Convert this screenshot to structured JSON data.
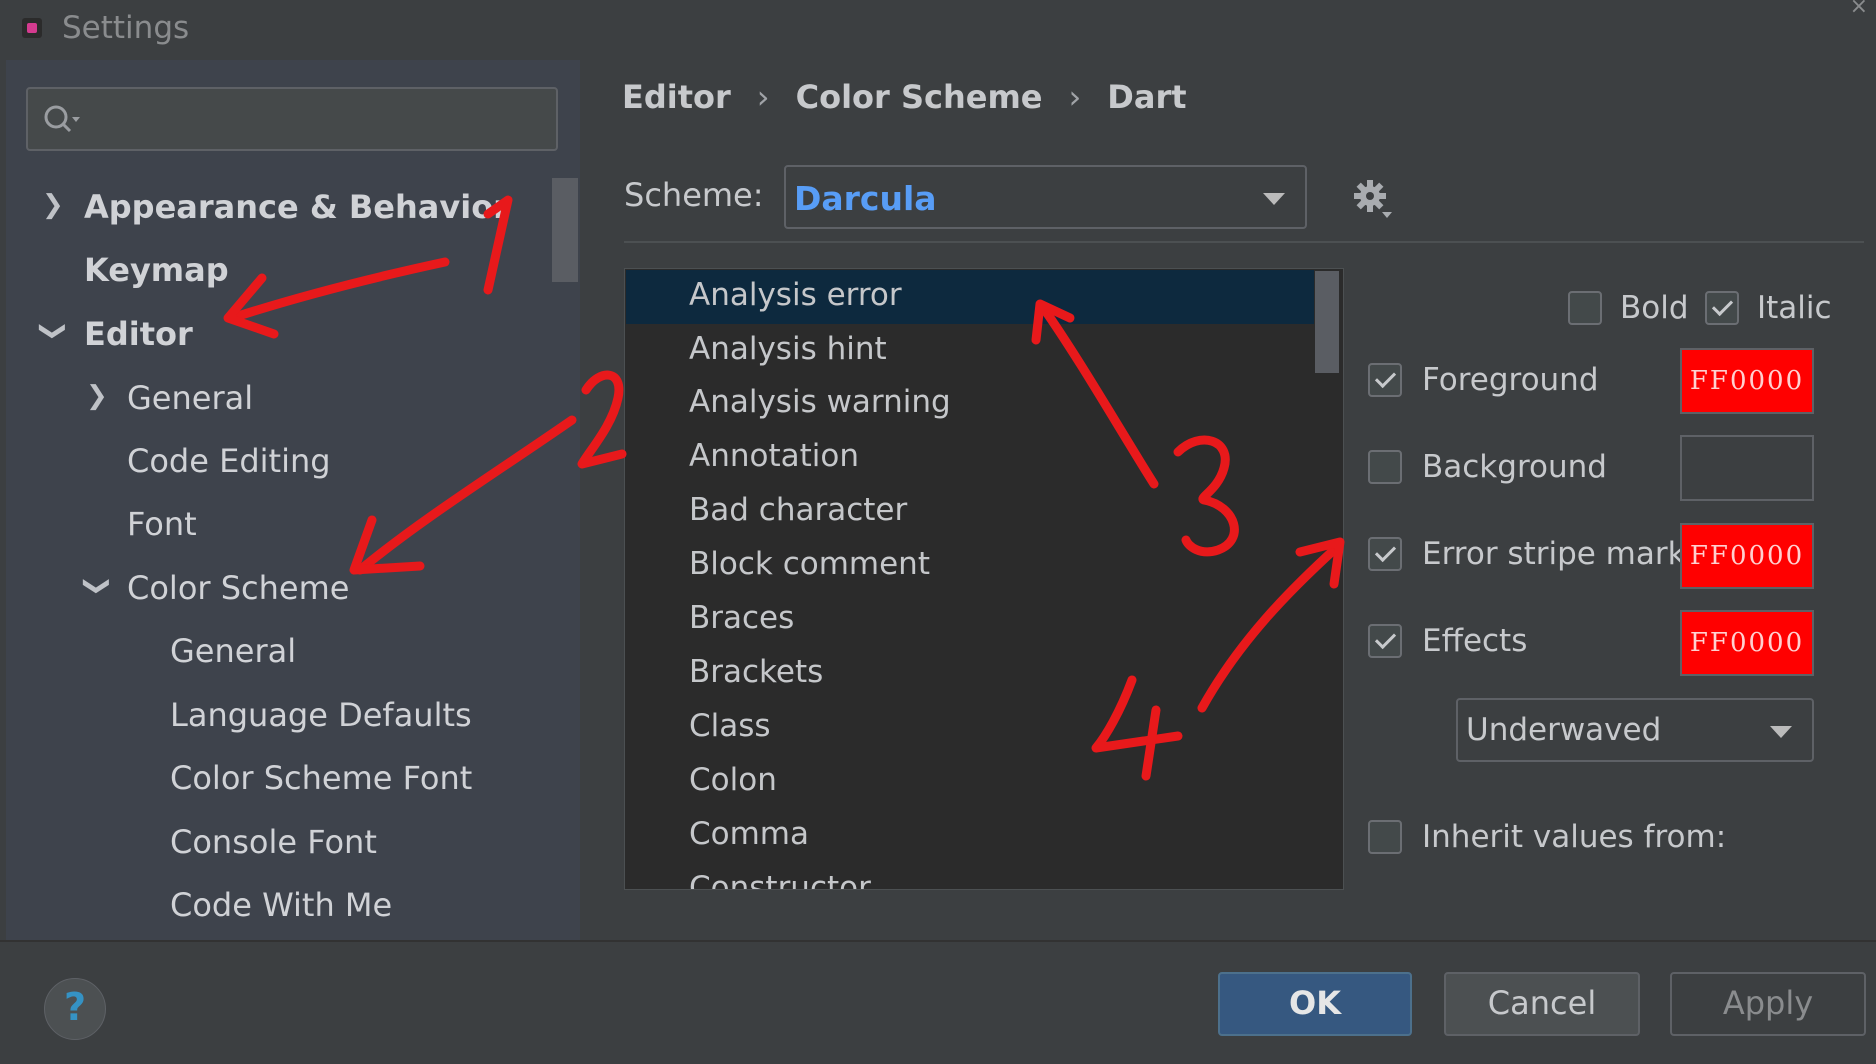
{
  "window": {
    "title": "Settings"
  },
  "sidebar": {
    "search": {
      "placeholder": "",
      "value": ""
    },
    "items": [
      {
        "label": "Appearance & Behavior",
        "expanded": false
      },
      {
        "label": "Keymap"
      },
      {
        "label": "Editor",
        "expanded": true
      },
      {
        "label": "General",
        "expanded": false
      },
      {
        "label": "Code Editing"
      },
      {
        "label": "Font"
      },
      {
        "label": "Color Scheme",
        "expanded": true
      },
      {
        "label": "General"
      },
      {
        "label": "Language Defaults"
      },
      {
        "label": "Color Scheme Font"
      },
      {
        "label": "Console Font"
      },
      {
        "label": "Code With Me"
      }
    ]
  },
  "breadcrumb": [
    "Editor",
    "Color Scheme",
    "Dart"
  ],
  "scheme": {
    "label": "Scheme:",
    "value": "Darcula"
  },
  "attributes": {
    "selected": "Analysis error",
    "items": [
      "Analysis error",
      "Analysis hint",
      "Analysis warning",
      "Annotation",
      "Bad character",
      "Block comment",
      "Braces",
      "Brackets",
      "Class",
      "Colon",
      "Comma",
      "Constructor"
    ]
  },
  "options": {
    "bold": {
      "label": "Bold",
      "checked": false
    },
    "italic": {
      "label": "Italic",
      "checked": true
    },
    "foreground": {
      "label": "Foreground",
      "checked": true,
      "color": "FF0000"
    },
    "background": {
      "label": "Background",
      "checked": false,
      "color": ""
    },
    "error_stripe": {
      "label": "Error stripe mark",
      "checked": true,
      "color": "FF0000"
    },
    "effects": {
      "label": "Effects",
      "checked": true,
      "color": "FF0000",
      "type": "Underwaved"
    },
    "inherit": {
      "label": "Inherit values from:",
      "checked": false
    }
  },
  "footer": {
    "help": "?",
    "ok": "OK",
    "cancel": "Cancel",
    "apply": "Apply"
  },
  "annotations": [
    "1",
    "2",
    "3",
    "4"
  ],
  "colors": {
    "swatch_red": "#ff0000",
    "annotation_red": "#e8191b",
    "accent_blue": "#589df6",
    "selection": "#0d293e"
  }
}
